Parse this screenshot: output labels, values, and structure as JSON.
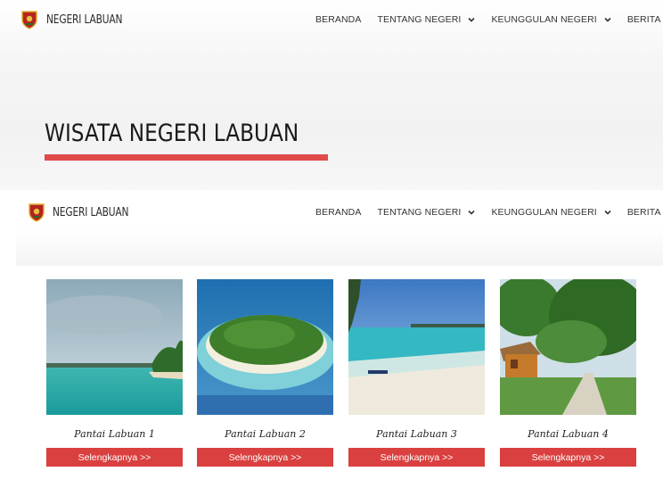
{
  "site": {
    "brand": "NEGERI LABUAN"
  },
  "nav": {
    "items": [
      {
        "label": "BERANDA",
        "has_dropdown": false
      },
      {
        "label": "TENTANG NEGERI",
        "has_dropdown": true
      },
      {
        "label": "KEUNGGULAN NEGERI",
        "has_dropdown": true
      },
      {
        "label": "BERITA",
        "has_dropdown": false
      }
    ],
    "search_icon": "search-icon"
  },
  "hero": {
    "title": "WISATA NEGERI LABUAN",
    "underline_color": "#e04a4a"
  },
  "cards": [
    {
      "caption": "Pantai Labuan 1",
      "button": "Selengkapnya >>"
    },
    {
      "caption": "Pantai Labuan 2",
      "button": "Selengkapnya >>"
    },
    {
      "caption": "Pantai Labuan 3",
      "button": "Selengkapnya >>"
    },
    {
      "caption": "Pantai Labuan 4",
      "button": "Selengkapnya >>"
    }
  ],
  "colors": {
    "accent": "#d9403f"
  }
}
